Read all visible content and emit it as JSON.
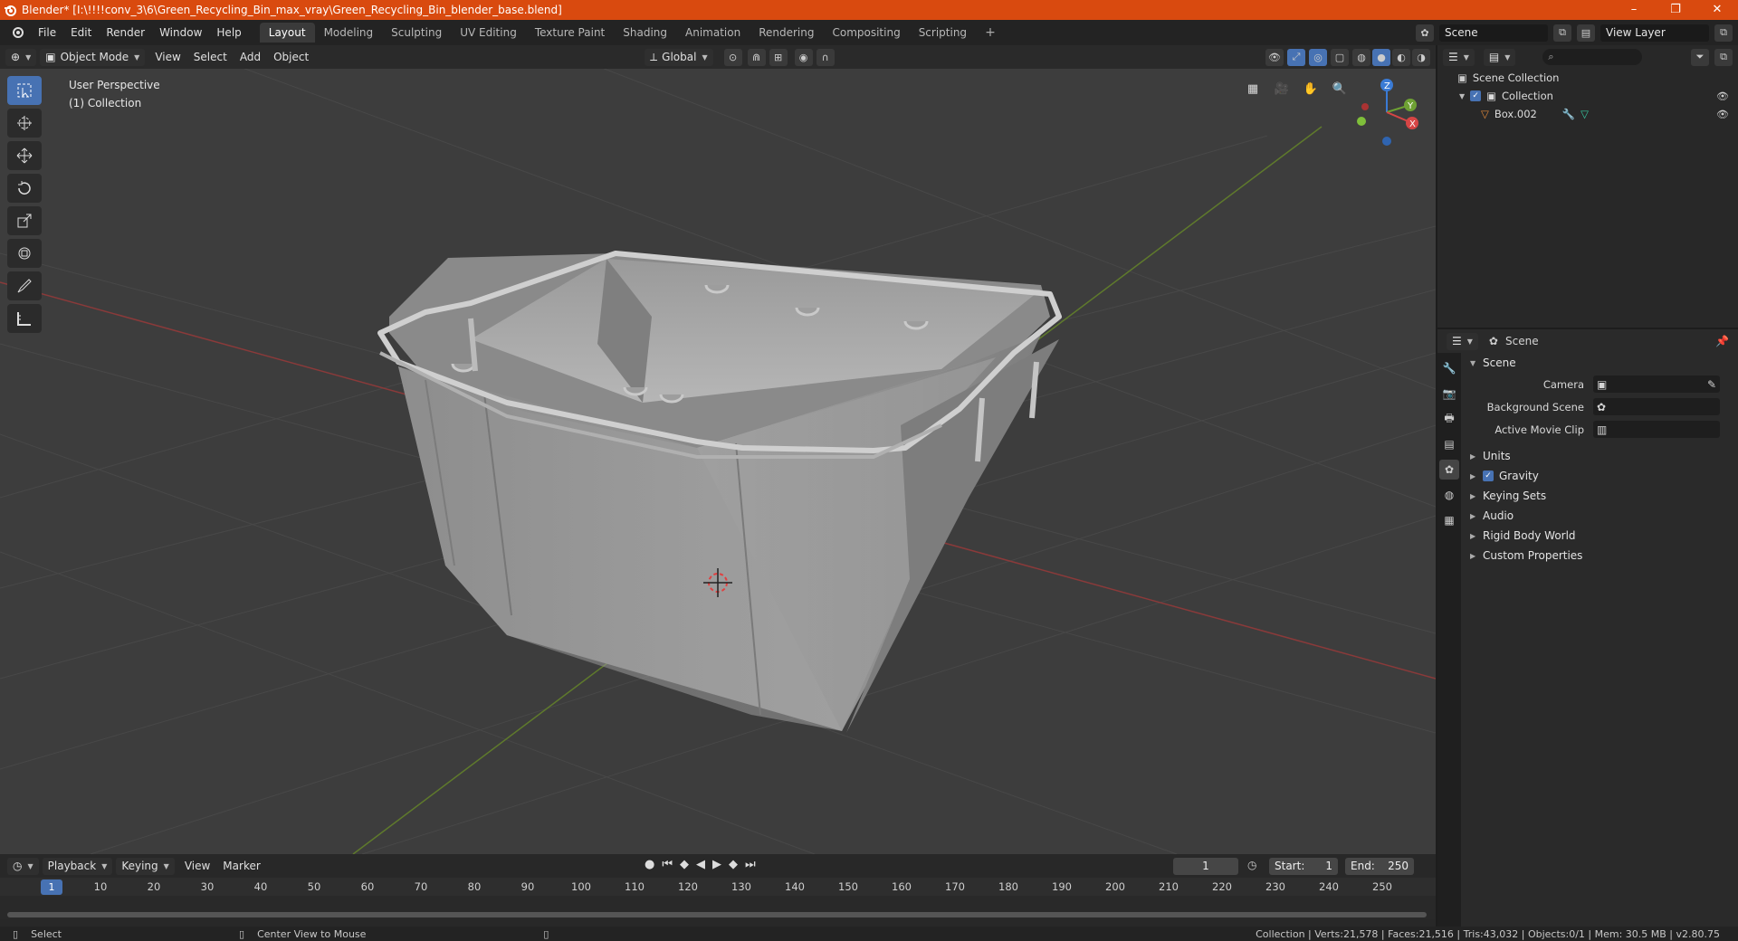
{
  "window": {
    "title": "Blender* [I:\\!!!!conv_3\\6\\Green_Recycling_Bin_max_vray\\Green_Recycling_Bin_blender_base.blend]",
    "minimize": "–",
    "maximize": "❐",
    "close": "✕"
  },
  "menu": [
    "File",
    "Edit",
    "Render",
    "Window",
    "Help"
  ],
  "workspaces": [
    {
      "label": "Layout",
      "active": true
    },
    {
      "label": "Modeling"
    },
    {
      "label": "Sculpting"
    },
    {
      "label": "UV Editing"
    },
    {
      "label": "Texture Paint"
    },
    {
      "label": "Shading"
    },
    {
      "label": "Animation"
    },
    {
      "label": "Rendering"
    },
    {
      "label": "Compositing"
    },
    {
      "label": "Scripting"
    }
  ],
  "workspace_add": "+",
  "scene_selector": {
    "scene": "Scene",
    "view_layer": "View Layer"
  },
  "viewport": {
    "mode": "Object Mode",
    "menus": [
      "View",
      "Select",
      "Add",
      "Object"
    ],
    "transform_orientation": "Global",
    "overlay_line1": "User Perspective",
    "overlay_line2": "(1) Collection",
    "gizmo": {
      "x": "X",
      "y": "Y",
      "z": "Z"
    }
  },
  "timeline": {
    "menus": [
      "Playback",
      "Keying",
      "View",
      "Marker"
    ],
    "current_frame": "1",
    "start_label": "Start:",
    "start": "1",
    "end_label": "End:",
    "end": "250",
    "ticks": [
      "10",
      "20",
      "30",
      "40",
      "50",
      "60",
      "70",
      "80",
      "90",
      "100",
      "110",
      "120",
      "130",
      "140",
      "150",
      "160",
      "170",
      "180",
      "190",
      "200",
      "210",
      "220",
      "230",
      "240",
      "250"
    ],
    "cursor": "1"
  },
  "status": {
    "select": "Select",
    "center": "Center View to Mouse",
    "stats": "Collection | Verts:21,578 | Faces:21,516 | Tris:43,032 | Objects:0/1 | Mem: 30.5 MB | v2.80.75"
  },
  "outliner": {
    "root": "Scene Collection",
    "collection": "Collection",
    "object": "Box.002"
  },
  "properties": {
    "context": "Scene",
    "panel": "Scene",
    "camera_label": "Camera",
    "background_label": "Background Scene",
    "movieclip_label": "Active Movie Clip",
    "sections": [
      "Units",
      "Gravity",
      "Keying Sets",
      "Audio",
      "Rigid Body World",
      "Custom Properties"
    ]
  },
  "colors": {
    "accent": "#4772b3",
    "titlebar": "#d94a0f",
    "viewport_bg": "#3d3d3d"
  }
}
